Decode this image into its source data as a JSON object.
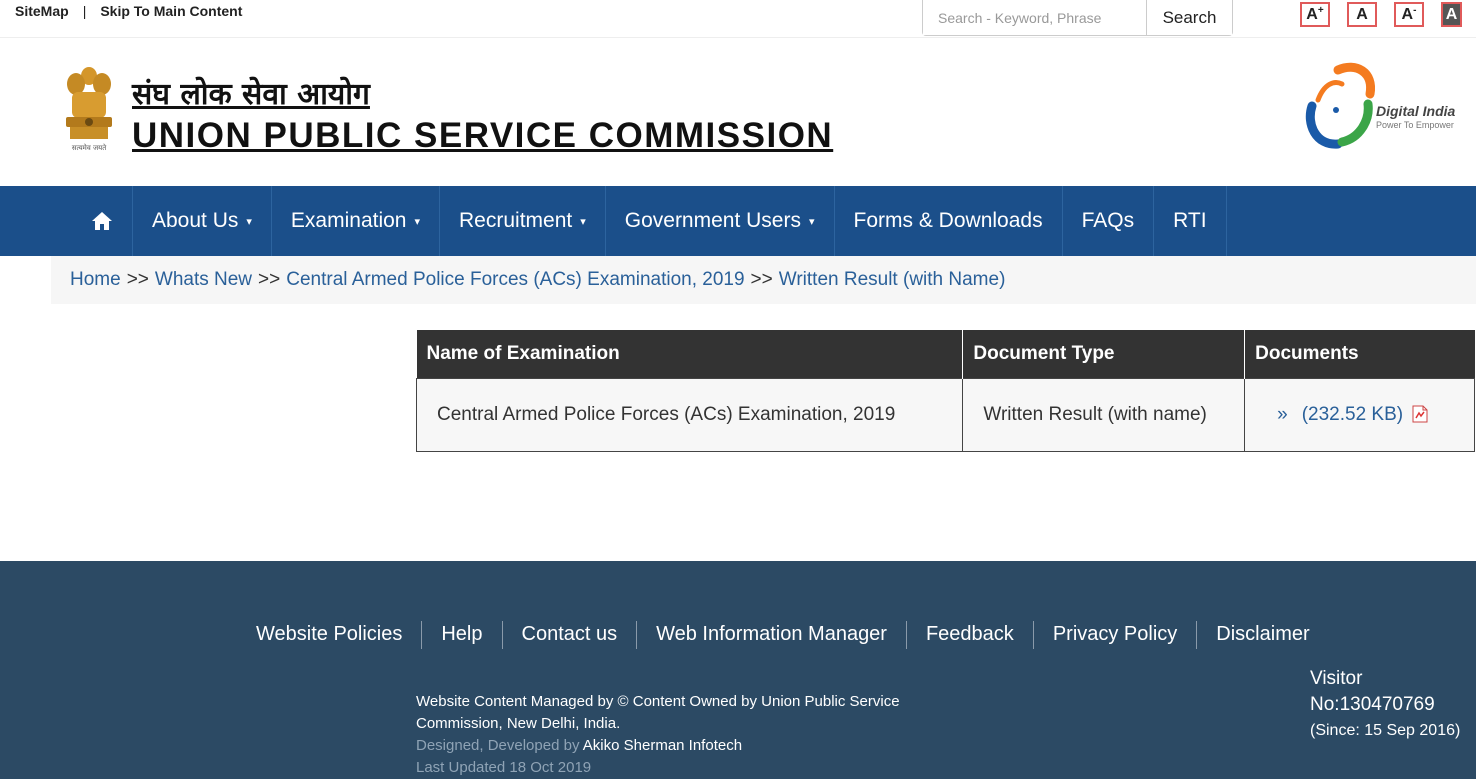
{
  "topbar": {
    "sitemap": "SiteMap",
    "separator": "|",
    "skip": "Skip To Main Content",
    "search_placeholder": "Search - Keyword, Phrase",
    "search_button": "Search",
    "font_increase": "A",
    "font_normal": "A",
    "font_decrease": "A",
    "contrast": "A"
  },
  "header": {
    "title_hindi": "संघ लोक सेवा आयोग",
    "title_english": "UNION PUBLIC SERVICE COMMISSION",
    "emblem_caption": "सत्यमेव जयते",
    "digital_india": "Digital India",
    "digital_india_tagline": "Power To Empower"
  },
  "nav": {
    "items": [
      {
        "label": "About Us",
        "dropdown": "▾"
      },
      {
        "label": "Examination",
        "dropdown": "▾"
      },
      {
        "label": "Recruitment",
        "dropdown": "▾"
      },
      {
        "label": "Government Users",
        "dropdown": "▾"
      },
      {
        "label": "Forms & Downloads"
      },
      {
        "label": "FAQs"
      },
      {
        "label": "RTI"
      }
    ]
  },
  "breadcrumb": {
    "items": [
      "Home",
      "Whats New",
      "Central Armed Police Forces (ACs) Examination, 2019",
      "Written Result (with Name)"
    ],
    "separator": ">>"
  },
  "table": {
    "headers": [
      "Name of Examination",
      "Document Type",
      "Documents"
    ],
    "rows": [
      {
        "exam": "Central Armed Police Forces (ACs) Examination, 2019",
        "type": "Written Result (with name)",
        "bullet": "»",
        "doc_size": "(232.52 KB)"
      }
    ]
  },
  "footer": {
    "links": [
      "Website Policies",
      "Help",
      "Contact us",
      "Web Information Manager",
      "Feedback",
      "Privacy Policy",
      "Disclaimer"
    ],
    "managed_line1": "Website Content Managed by © Content Owned by Union Public Service",
    "managed_line2": "Commission, New Delhi, India.",
    "designed_prefix": "Designed, Developed by",
    "designed_by": "Akiko Sherman Infotech",
    "last_updated": "Last Updated 18 Oct 2019",
    "visitor_label": "Visitor",
    "visitor_no": "No:130470769",
    "visitor_since": "(Since: 15 Sep 2016)"
  },
  "colors": {
    "nav_bg": "#1b4f8a",
    "footer_bg": "#2c4a64",
    "table_header_bg": "#333333",
    "link": "#2a6099",
    "font_ctrl_border": "#e05a5a"
  }
}
